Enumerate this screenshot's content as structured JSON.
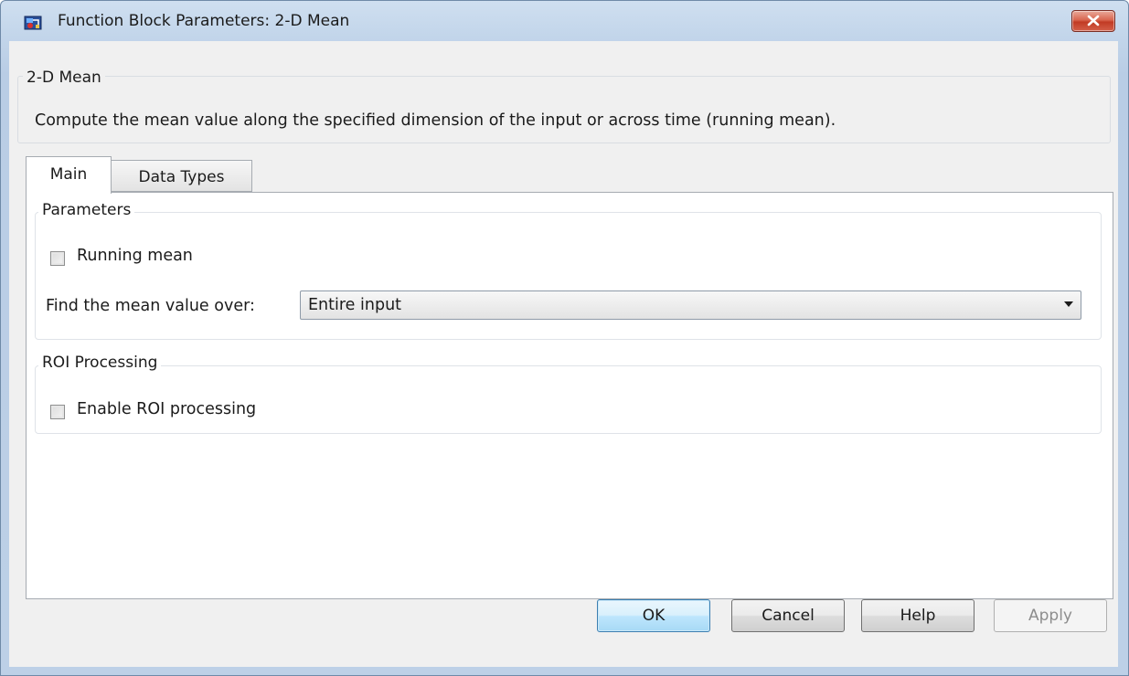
{
  "window": {
    "title": "Function Block Parameters: 2-D Mean"
  },
  "description": {
    "group_title": "2-D Mean",
    "text": "Compute the mean value along the specified dimension of the input or across time (running mean)."
  },
  "tabs": [
    {
      "label": "Main",
      "active": true
    },
    {
      "label": "Data Types",
      "active": false
    }
  ],
  "parameters": {
    "group_title": "Parameters",
    "running_mean": {
      "label": "Running mean",
      "checked": false
    },
    "mean_over": {
      "label": "Find the mean value over:",
      "value": "Entire input"
    }
  },
  "roi": {
    "group_title": "ROI Processing",
    "enable_roi": {
      "label": "Enable ROI processing",
      "checked": false
    }
  },
  "buttons": {
    "ok": "OK",
    "cancel": "Cancel",
    "help": "Help",
    "apply": "Apply"
  }
}
